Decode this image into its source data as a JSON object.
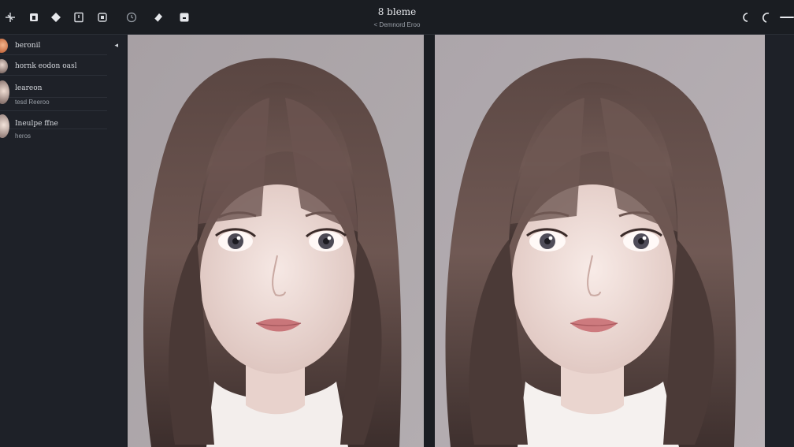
{
  "window": {
    "title": "8 bleme",
    "subtitle": "< Demnord Eroo"
  },
  "toolbar": {
    "left_icons": [
      "transform-icon",
      "layers-square-icon",
      "diamond-icon",
      "crop-icon",
      "frame-icon"
    ],
    "center_icons": [
      "history-clock-icon",
      "eraser-icon",
      "mask-icon"
    ],
    "right_icons": [
      "undo-arc-icon",
      "redo-arc-icon",
      "zoom-slider"
    ]
  },
  "sidebar": {
    "collapse_glyph": "◂",
    "layers": [
      {
        "label": "beronil",
        "sub": ""
      },
      {
        "label": "hornk eodon oasl",
        "sub": ""
      },
      {
        "label": "leareon",
        "sub": "tesd Reeroo"
      },
      {
        "label": "Ineulpe ffne",
        "sub": "heros"
      }
    ]
  },
  "canvases": [
    {
      "name": "original-preview",
      "background": "#a59fa3"
    },
    {
      "name": "edited-preview",
      "background": "#aaa3a8"
    }
  ],
  "colors": {
    "accent": "#e8eaee",
    "hair": "#4a3936",
    "skin": "#ecd9d5",
    "lips": "#c9767a"
  }
}
